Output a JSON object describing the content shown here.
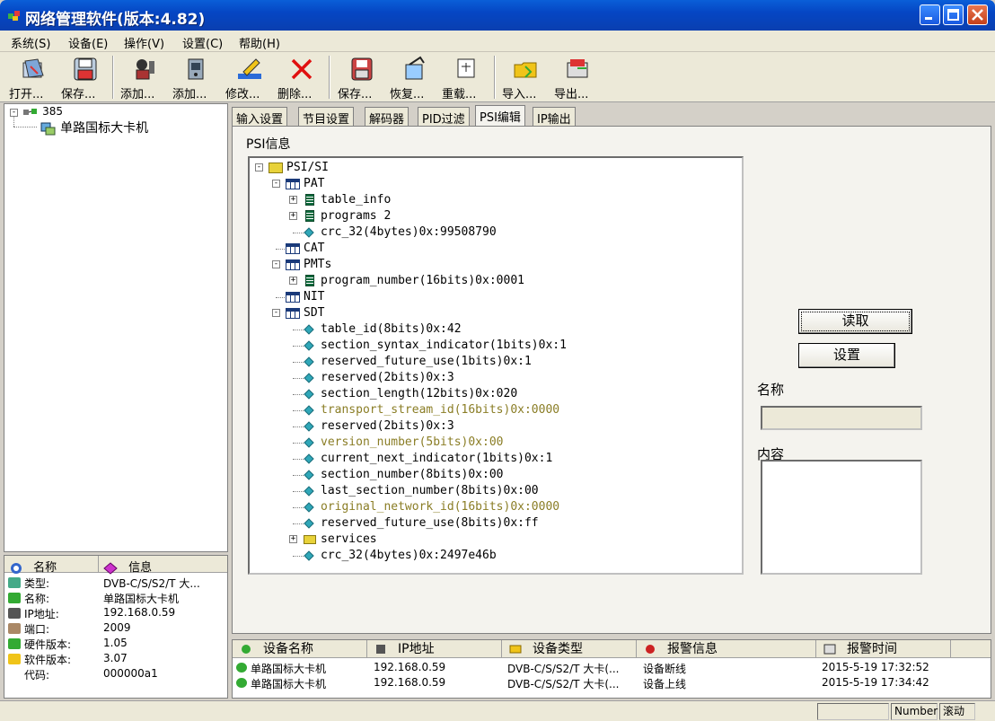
{
  "window": {
    "title": "网络管理软件(版本:4.82)"
  },
  "menu": [
    "系统(S)",
    "设备(E)",
    "操作(V)",
    "设置(C)",
    "帮助(H)"
  ],
  "toolbar": [
    "打开...",
    "保存...",
    "添加...",
    "添加...",
    "修改...",
    "删除...",
    "保存...",
    "恢复...",
    "重载...",
    "导入...",
    "导出..."
  ],
  "tree": {
    "root": "385",
    "device": "单路国标大卡机"
  },
  "info": {
    "headers": [
      "名称",
      "信息"
    ],
    "rows": [
      {
        "k": "类型:",
        "v": "DVB-C/S/S2/T 大...",
        "icon": "type-icon"
      },
      {
        "k": "名称:",
        "v": "单路国标大卡机",
        "icon": "name-icon"
      },
      {
        "k": "IP地址:",
        "v": "192.168.0.59",
        "icon": "ip-icon"
      },
      {
        "k": "端口:",
        "v": "2009",
        "icon": "port-icon"
      },
      {
        "k": "硬件版本:",
        "v": "1.05",
        "icon": "hardware-icon"
      },
      {
        "k": "软件版本:",
        "v": "3.07",
        "icon": "software-icon"
      },
      {
        "k": "代码:",
        "v": "000000a1",
        "icon": ""
      }
    ]
  },
  "tabs": [
    "输入设置",
    "节目设置",
    "解码器",
    "PID过滤",
    "PSI编辑",
    "IP输出"
  ],
  "active_tab": "PSI编辑",
  "psi": {
    "label": "PSI信息",
    "nodes": [
      {
        "text": "PSI/SI",
        "kind": "root",
        "exp": "-"
      },
      {
        "text": "PAT",
        "kind": "table",
        "exp": "-"
      },
      {
        "text": "table_info",
        "kind": "list",
        "exp": "+"
      },
      {
        "text": "programs 2",
        "kind": "list",
        "exp": "+"
      },
      {
        "text": "crc_32(4bytes)0x:99508790",
        "kind": "leaf"
      },
      {
        "text": "CAT",
        "kind": "table"
      },
      {
        "text": "PMTs",
        "kind": "table",
        "exp": "-"
      },
      {
        "text": "program_number(16bits)0x:0001",
        "kind": "list",
        "exp": "+"
      },
      {
        "text": "NIT",
        "kind": "table"
      },
      {
        "text": "SDT",
        "kind": "table",
        "exp": "-"
      },
      {
        "text": "table_id(8bits)0x:42",
        "kind": "leaf"
      },
      {
        "text": "section_syntax_indicator(1bits)0x:1",
        "kind": "leaf"
      },
      {
        "text": "reserved_future_use(1bits)0x:1",
        "kind": "leaf"
      },
      {
        "text": "reserved(2bits)0x:3",
        "kind": "leaf"
      },
      {
        "text": "section_length(12bits)0x:020",
        "kind": "leaf"
      },
      {
        "text": "transport_stream_id(16bits)0x:0000",
        "kind": "leaf",
        "editable": true
      },
      {
        "text": "reserved(2bits)0x:3",
        "kind": "leaf"
      },
      {
        "text": "version_number(5bits)0x:00",
        "kind": "leaf",
        "editable": true
      },
      {
        "text": "current_next_indicator(1bits)0x:1",
        "kind": "leaf"
      },
      {
        "text": "section_number(8bits)0x:00",
        "kind": "leaf"
      },
      {
        "text": "last_section_number(8bits)0x:00",
        "kind": "leaf"
      },
      {
        "text": "original_network_id(16bits)0x:0000",
        "kind": "leaf",
        "editable": true
      },
      {
        "text": "reserved_future_use(8bits)0x:ff",
        "kind": "leaf"
      },
      {
        "text": "services",
        "kind": "folder",
        "exp": "+"
      },
      {
        "text": "crc_32(4bytes)0x:2497e46b",
        "kind": "leaf"
      }
    ]
  },
  "side": {
    "read_button": "读取",
    "set_button": "设置",
    "name_label": "名称",
    "name_value": "",
    "content_label": "内容",
    "content_value": ""
  },
  "alarm": {
    "headers": [
      "设备名称",
      "IP地址",
      "设备类型",
      "报警信息",
      "报警时间"
    ],
    "rows": [
      [
        "单路国标大卡机",
        "192.168.0.59",
        "DVB-C/S/S2/T 大卡(...",
        "设备断线",
        "2015-5-19 17:32:52"
      ],
      [
        "单路国标大卡机",
        "192.168.0.59",
        "DVB-C/S/S2/T 大卡(...",
        "设备上线",
        "2015-5-19 17:34:42"
      ]
    ]
  },
  "status": {
    "number": "Number",
    "scroll": "滚动"
  },
  "colors": {
    "titlebar": "#0546c4",
    "editable_field": "#8a7d25",
    "leaf_icon": "#2fa7b8"
  }
}
